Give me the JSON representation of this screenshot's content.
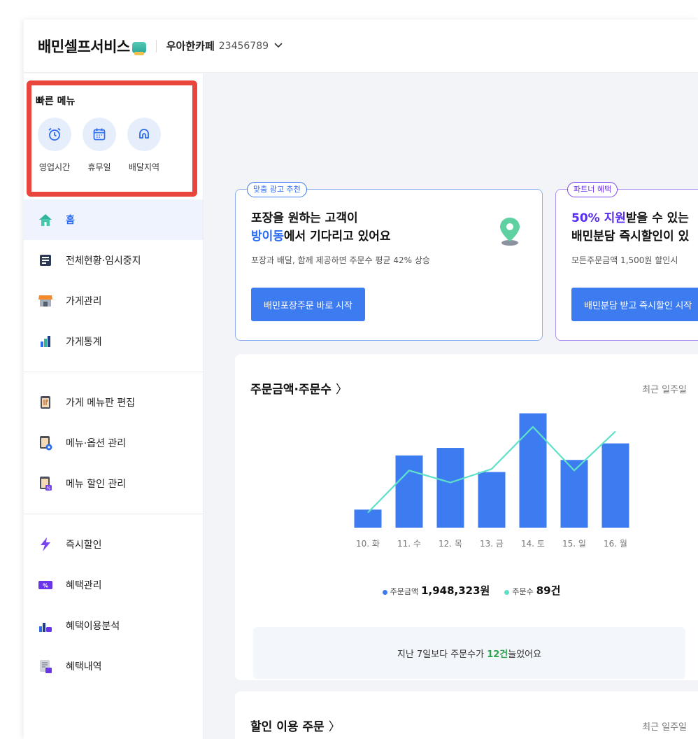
{
  "header": {
    "logo": "배민셀프서비스",
    "store_name": "우아한카페",
    "store_id": "23456789"
  },
  "quick_menu": {
    "title": "빠른 메뉴",
    "items": [
      {
        "label": "영업시간",
        "icon": "alarm-clock-icon"
      },
      {
        "label": "휴무일",
        "icon": "calendar-icon"
      },
      {
        "label": "배달지역",
        "icon": "delivery-area-icon"
      }
    ]
  },
  "sidebar": {
    "items": [
      {
        "label": "홈",
        "icon": "home-icon",
        "active": true
      },
      {
        "label": "전체현황·임시중지",
        "icon": "status-board-icon"
      },
      {
        "label": "가게관리",
        "icon": "store-icon"
      },
      {
        "label": "가게통계",
        "icon": "bar-stats-icon"
      },
      {
        "label": "가게 메뉴판 편집",
        "icon": "menu-board-icon"
      },
      {
        "label": "메뉴·옵션 관리",
        "icon": "menu-options-icon"
      },
      {
        "label": "메뉴 할인 관리",
        "icon": "menu-discount-icon"
      },
      {
        "label": "즉시할인",
        "icon": "instant-discount-icon"
      },
      {
        "label": "혜택관리",
        "icon": "benefit-manage-icon"
      },
      {
        "label": "혜택이용분석",
        "icon": "benefit-analysis-icon"
      },
      {
        "label": "혜택내역",
        "icon": "benefit-history-icon"
      }
    ]
  },
  "ad_cards": [
    {
      "tag": "맞춤 광고 추천",
      "title_line1": "포장을 원하는 고객이",
      "title_line2_highlight": "방이동",
      "title_line2_rest": "에서 기다리고 있어요",
      "desc": "포장과 배달, 함께 제공하면 주문수 평균 42% 상승",
      "button": "배민포장주문 바로 시작"
    },
    {
      "tag": "파트너 혜택",
      "title_line1_highlight": "50% 지원",
      "title_line1_rest": "받을 수 있는",
      "title_line2": "배민분담 즉시할인이 있",
      "desc": "모든주문금액 1,500원 할인시",
      "button": "배민분담 받고 즉시할인 시작"
    }
  ],
  "order_card": {
    "title": "주문금액·주문수",
    "arrow": "〉",
    "range": "최근 일주일",
    "legend": {
      "amount_label": "주문금액",
      "amount_value": "1,948,323원",
      "count_label": "주문수",
      "count_value": "89건"
    },
    "summary_prefix": "지난 7일보다 주문수가 ",
    "summary_highlight": "12건",
    "summary_suffix": " 늘었어요"
  },
  "discount_card": {
    "title": "할인 이용 주문",
    "arrow": "〉",
    "range": "최근 일주일"
  },
  "colors": {
    "bar": "#3d7bf0",
    "line": "#5fe0c8",
    "accent_blue": "#2b6cf0",
    "accent_purple": "#6a35e8",
    "highlight_red": "#e8453c"
  },
  "chart_data": {
    "type": "bar",
    "categories": [
      "10. 화",
      "11. 수",
      "12. 목",
      "13. 금",
      "14. 토",
      "15. 일",
      "16. 월"
    ],
    "series": [
      {
        "name": "주문금액",
        "type": "bar",
        "values": [
          12,
          48,
          53,
          37,
          76,
          45,
          56
        ]
      },
      {
        "name": "주문수",
        "type": "line",
        "values": [
          10,
          38,
          30,
          39,
          67,
          38,
          64
        ]
      }
    ],
    "ylim": [
      0,
      80
    ]
  }
}
